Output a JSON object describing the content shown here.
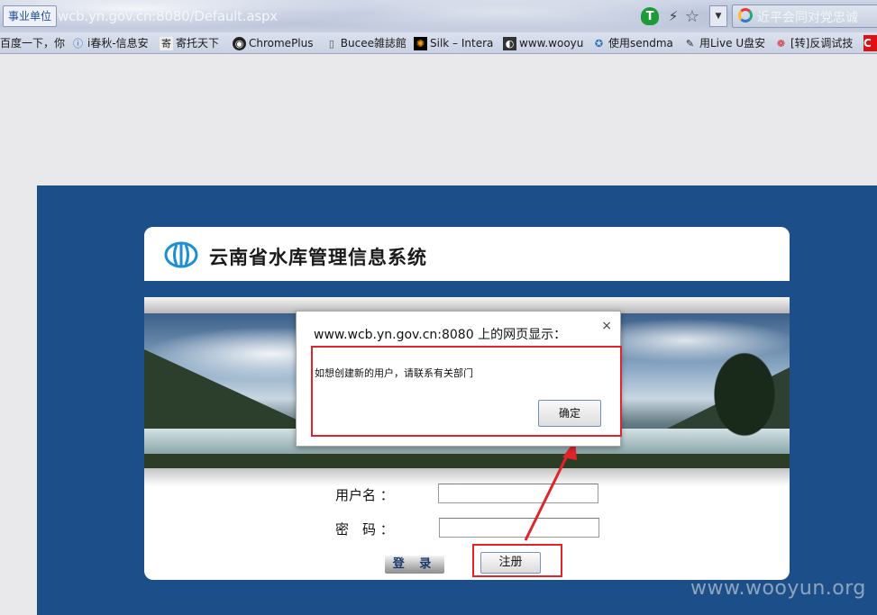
{
  "browser": {
    "tag_label": "事业单位",
    "url": "wcb.yn.gov.cn:8080/Default.aspx",
    "search_text": "近平会同对党忠诚",
    "bookmarks": [
      {
        "label": "百度一下，你",
        "icon": "page-icon"
      },
      {
        "label": "i春秋-信息安",
        "icon": "ichunqiu-icon"
      },
      {
        "label": "寄托天下",
        "icon": "gter-icon"
      },
      {
        "label": "ChromePlus",
        "icon": "github-icon"
      },
      {
        "label": "Bucee雑誌館",
        "icon": "page-icon"
      },
      {
        "label": "Silk – Intera",
        "icon": "silk-icon"
      },
      {
        "label": "www.wooyu",
        "icon": "wooyun-icon"
      },
      {
        "label": "使用sendma",
        "icon": "sendmail-icon"
      },
      {
        "label": "用Live U盘安",
        "icon": "tool-icon"
      },
      {
        "label": "[转]反调试技",
        "icon": "weibo-icon"
      }
    ]
  },
  "page": {
    "system_title": "云南省水库管理信息系统",
    "username_label": "用户名 ：",
    "password_label": "密　码 ：",
    "login_button": "登 录",
    "register_button": "注册"
  },
  "dialog": {
    "title": "www.wcb.yn.gov.cn:8080 上的网页显示：",
    "message": "如想创建新的用户，请联系有关部门",
    "ok_button": "确定",
    "close_symbol": "×"
  },
  "watermark": "www.wooyun.org",
  "colors": {
    "page_blue": "#1c4e8a",
    "annotation_red": "#e0242c"
  }
}
